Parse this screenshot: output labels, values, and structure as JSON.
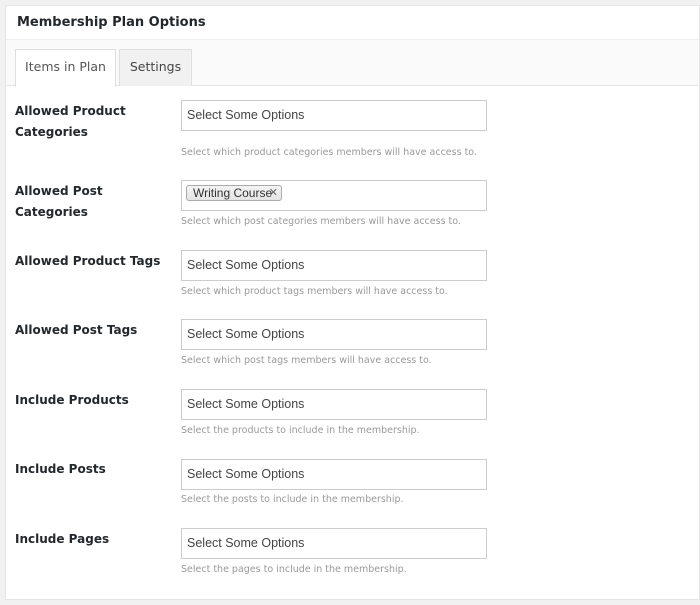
{
  "panel": {
    "title": "Membership Plan Options"
  },
  "tabs": [
    {
      "label": "Items in Plan",
      "active": true
    },
    {
      "label": "Settings",
      "active": false
    }
  ],
  "fields": [
    {
      "label": "Allowed Product Categories",
      "placeholder": "Select Some Options",
      "help": "Select which product categories members will have access to."
    },
    {
      "label": "Allowed Post Categories",
      "selected": [
        "Writing Course"
      ],
      "help": "Select which post categories members will have access to."
    },
    {
      "label": "Allowed Product Tags",
      "placeholder": "Select Some Options",
      "help": "Select which product tags members will have access to."
    },
    {
      "label": "Allowed Post Tags",
      "placeholder": "Select Some Options",
      "help": "Select which post tags members will have access to."
    },
    {
      "label": "Include Products",
      "placeholder": "Select Some Options",
      "help": "Select the products to include in the membership."
    },
    {
      "label": "Include Posts",
      "placeholder": "Select Some Options",
      "help": "Select the posts to include in the membership."
    },
    {
      "label": "Include Pages",
      "placeholder": "Select Some Options",
      "help": "Select the pages to include in the membership."
    }
  ],
  "icons": {
    "chip_remove": "close-icon"
  },
  "colors": {
    "background": "#f1f1f1",
    "panel": "#ffffff",
    "help_text": "#999999",
    "border": "#cccccc"
  }
}
